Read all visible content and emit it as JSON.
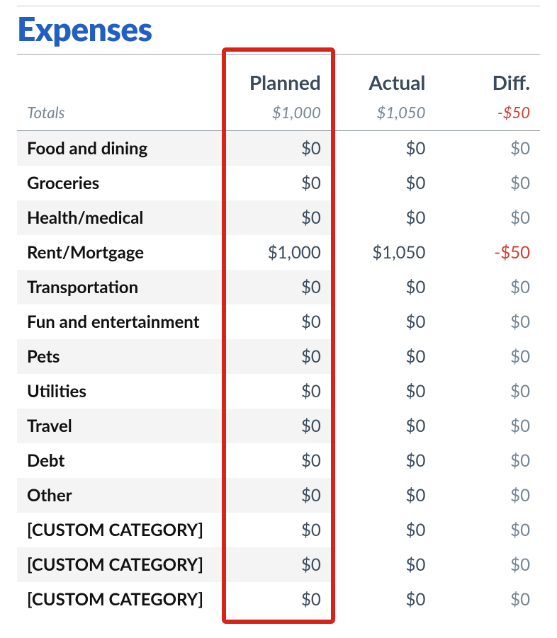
{
  "title": "Expenses",
  "columns": {
    "category_header": "",
    "planned": "Planned",
    "actual": "Actual",
    "diff": "Diff."
  },
  "totals": {
    "label": "Totals",
    "planned": "$1,000",
    "actual": "$1,050",
    "diff": "-$50",
    "diff_negative": true
  },
  "rows": [
    {
      "category": "Food and dining",
      "planned": "$0",
      "actual": "$0",
      "diff": "$0",
      "diff_negative": false
    },
    {
      "category": "Groceries",
      "planned": "$0",
      "actual": "$0",
      "diff": "$0",
      "diff_negative": false
    },
    {
      "category": "Health/medical",
      "planned": "$0",
      "actual": "$0",
      "diff": "$0",
      "diff_negative": false
    },
    {
      "category": "Rent/Mortgage",
      "planned": "$1,000",
      "actual": "$1,050",
      "diff": "-$50",
      "diff_negative": true
    },
    {
      "category": "Transportation",
      "planned": "$0",
      "actual": "$0",
      "diff": "$0",
      "diff_negative": false
    },
    {
      "category": "Fun and entertainment",
      "planned": "$0",
      "actual": "$0",
      "diff": "$0",
      "diff_negative": false
    },
    {
      "category": "Pets",
      "planned": "$0",
      "actual": "$0",
      "diff": "$0",
      "diff_negative": false
    },
    {
      "category": "Utilities",
      "planned": "$0",
      "actual": "$0",
      "diff": "$0",
      "diff_negative": false
    },
    {
      "category": "Travel",
      "planned": "$0",
      "actual": "$0",
      "diff": "$0",
      "diff_negative": false
    },
    {
      "category": "Debt",
      "planned": "$0",
      "actual": "$0",
      "diff": "$0",
      "diff_negative": false
    },
    {
      "category": "Other",
      "planned": "$0",
      "actual": "$0",
      "diff": "$0",
      "diff_negative": false
    },
    {
      "category": "[CUSTOM CATEGORY]",
      "planned": "$0",
      "actual": "$0",
      "diff": "$0",
      "diff_negative": false
    },
    {
      "category": "[CUSTOM CATEGORY]",
      "planned": "$0",
      "actual": "$0",
      "diff": "$0",
      "diff_negative": false
    },
    {
      "category": "[CUSTOM CATEGORY]",
      "planned": "$0",
      "actual": "$0",
      "diff": "$0",
      "diff_negative": false
    }
  ],
  "highlight": {
    "column": "planned"
  }
}
